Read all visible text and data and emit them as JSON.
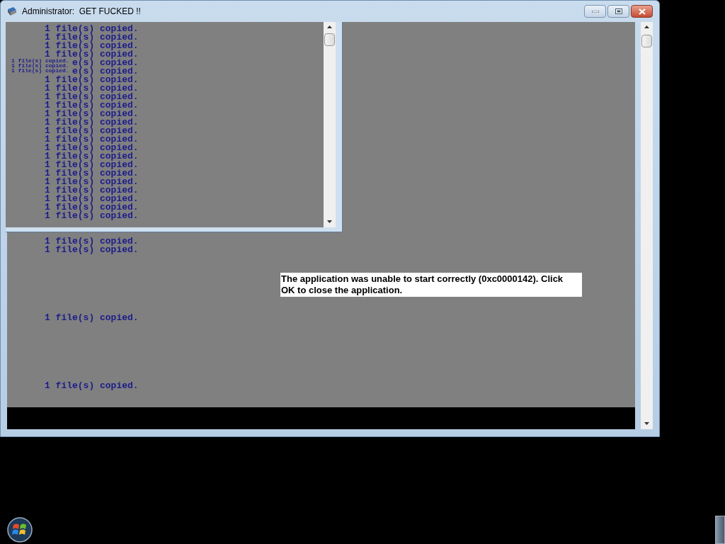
{
  "window": {
    "title": "Administrator:  GET FUCKED !!"
  },
  "overlay_window": {
    "lines": [
      {
        "kind": "full",
        "text": "1 file(s) copied."
      },
      {
        "kind": "full",
        "text": "1 file(s) copied."
      },
      {
        "kind": "full",
        "text": "1 file(s) copied."
      },
      {
        "kind": "full",
        "text": "1 file(s) copied."
      },
      {
        "kind": "partial",
        "text": "e(s) copied."
      },
      {
        "kind": "partial",
        "text": "e(s) copied."
      },
      {
        "kind": "full",
        "text": "1 file(s) copied."
      },
      "1 file(s) copied.",
      "1 file(s) copied.",
      "1 file(s) copied.",
      "1 file(s) copied.",
      "1 file(s) copied.",
      "1 file(s) copied.",
      "1 file(s) copied.",
      "1 file(s) copied.",
      "1 file(s) copied.",
      "1 file(s) copied.",
      "1 file(s) copied.",
      "1 file(s) copied.",
      "1 file(s) copied.",
      "1 file(s) copied.",
      "1 file(s) copied.",
      "1 file(s) copied."
    ],
    "small_lines": [
      "1 file(s) copied.",
      "1 file(s) copied.",
      "1 file(s) copied."
    ]
  },
  "console": {
    "lines": [
      {
        "kind": "text",
        "text": "1 file(s) copied."
      },
      {
        "kind": "text",
        "text": "1 file(s) copied."
      },
      {
        "kind": "blank"
      },
      {
        "kind": "blank"
      },
      {
        "kind": "blank"
      },
      {
        "kind": "blank"
      },
      {
        "kind": "blank"
      },
      {
        "kind": "blank"
      },
      {
        "kind": "blank"
      },
      {
        "kind": "text",
        "text": "1 file(s) copied."
      },
      {
        "kind": "blank"
      },
      {
        "kind": "blank"
      },
      {
        "kind": "blank"
      },
      {
        "kind": "blank"
      },
      {
        "kind": "blank"
      },
      {
        "kind": "blank"
      },
      {
        "kind": "blank"
      },
      {
        "kind": "text",
        "text": "1 file(s) copied."
      }
    ],
    "error_message": "The application was unable to start correctly (0xc0000142). Click OK to close the application."
  }
}
